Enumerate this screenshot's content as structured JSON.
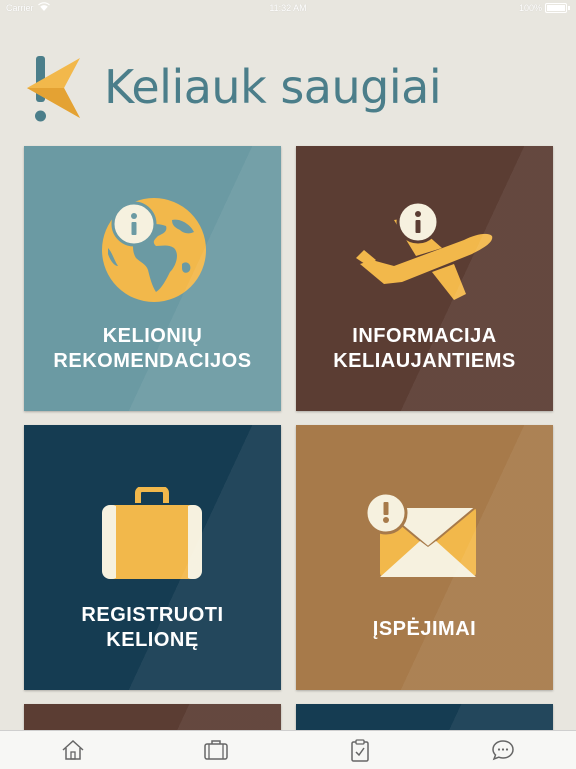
{
  "status_bar": {
    "carrier": "Carrier",
    "time": "11:32 AM",
    "battery": "100%"
  },
  "header": {
    "title": "Keliauk saugiai"
  },
  "tiles": [
    {
      "line1": "KELIONIŲ",
      "line2": "REKOMENDACIJOS",
      "icon": "globe-info-icon",
      "color": "#6b9aa3"
    },
    {
      "line1": "INFORMACIJA",
      "line2": "KELIAUJANTIEMS",
      "icon": "airplane-info-icon",
      "color": "#5b3d33"
    },
    {
      "line1": "REGISTRUOTI",
      "line2": "KELIONĘ",
      "icon": "suitcase-icon",
      "color": "#153c52"
    },
    {
      "line1": "ĮSPĖJIMAI",
      "icon": "envelope-alert-icon",
      "color": "#a77a4a"
    }
  ],
  "tab_bar": {
    "items": [
      {
        "icon": "home-icon"
      },
      {
        "icon": "suitcase-tab-icon"
      },
      {
        "icon": "clipboard-check-icon"
      },
      {
        "icon": "chat-bubble-icon"
      }
    ]
  },
  "colors": {
    "accent_yellow": "#f2b84b",
    "title_teal": "#4b7e8a",
    "background": "#e8e6df"
  }
}
